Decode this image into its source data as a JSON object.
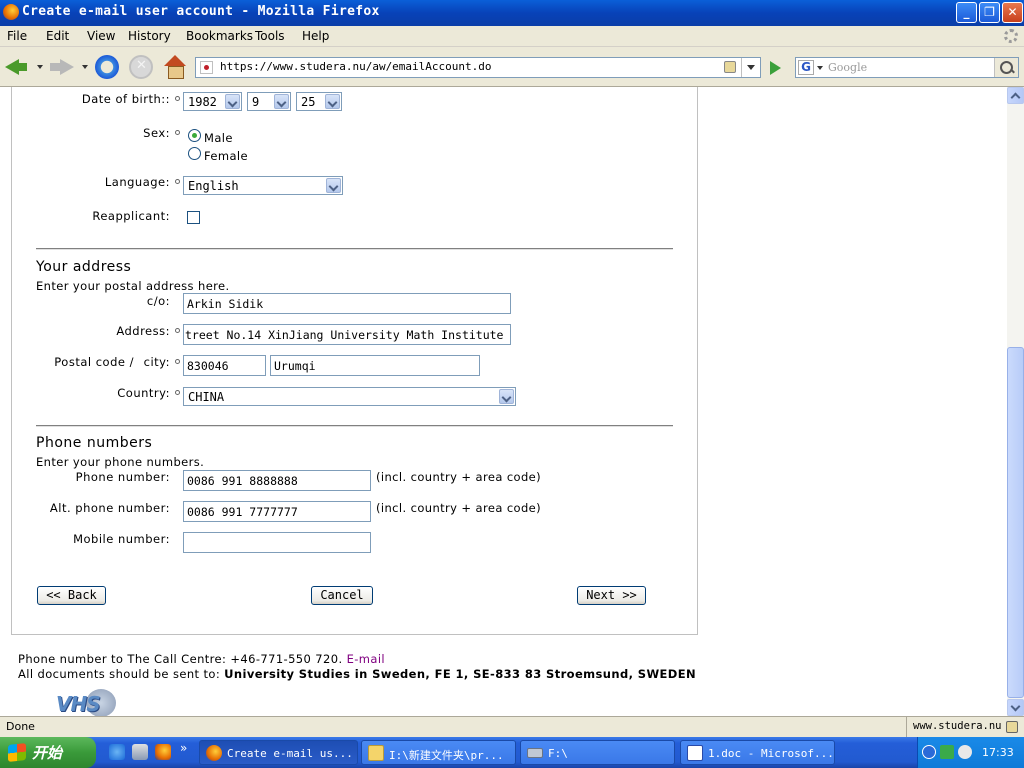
{
  "window": {
    "title": "Create e-mail user account - Mozilla Firefox",
    "buttons": {
      "minimize": "_",
      "restore": "❐",
      "close": "✕"
    }
  },
  "menu": [
    "File",
    "Edit",
    "View",
    "History",
    "Bookmarks",
    "Tools",
    "Help"
  ],
  "toolbar": {
    "url": "https://www.studera.nu/aw/emailAccount.do",
    "search_placeholder": "Google",
    "search_engine_letter": "G"
  },
  "form": {
    "dob": {
      "label": "Date of birth::",
      "year": "1982",
      "month": "9",
      "day": "25"
    },
    "sex": {
      "label": "Sex:",
      "options": [
        "Male",
        "Female"
      ],
      "selected": "Male"
    },
    "language": {
      "label": "Language:",
      "value": "English"
    },
    "reapplicant": {
      "label": "Reapplicant:",
      "checked": false
    },
    "address_section": {
      "heading": "Your address",
      "intro": "Enter your postal address here.",
      "co_label": "c/o:",
      "co_value": "Arkin Sidik",
      "address_label": "Address:",
      "address_value": "treet No.14 XinJiang University Math Institute",
      "postal_label": "Postal code /",
      "city_label": "city:",
      "postal_value": "830046",
      "city_value": "Urumqi",
      "country_label": "Country:",
      "country_value": "CHINA"
    },
    "phone_section": {
      "heading": "Phone numbers",
      "intro": "Enter your phone numbers.",
      "phone_label": "Phone number:",
      "phone_value": "0086 991 8888888",
      "phone_hint": "(incl. country + area code)",
      "alt_label": "Alt. phone number:",
      "alt_value": "0086 991 7777777",
      "alt_hint": "(incl. country + area code)",
      "mobile_label": "Mobile number:",
      "mobile_value": ""
    },
    "buttons": {
      "back": "<< Back",
      "cancel": "Cancel",
      "next": "Next >>"
    }
  },
  "footer": {
    "phone_prefix": "Phone number to The Call Centre: +46-771-550 720. ",
    "email_link": "E-mail",
    "docs_prefix": "All documents should be sent to: ",
    "docs_address": "University Studies in Sweden, FE 1, SE-833 83 Stroemsund, SWEDEN",
    "logo_text": "VHS"
  },
  "status": {
    "text": "Done",
    "host": "www.studera.nu"
  },
  "taskbar": {
    "start_label": "开始",
    "tasks": [
      "Create e-mail us...",
      "I:\\新建文件夹\\pr...",
      "F:\\",
      "1.doc - Microsof..."
    ],
    "clock": "17:33",
    "quicklaunch_more": "»"
  },
  "colors": {
    "link": "#800080",
    "taskbar": "#245ed8",
    "start": "#3a9a3a"
  }
}
